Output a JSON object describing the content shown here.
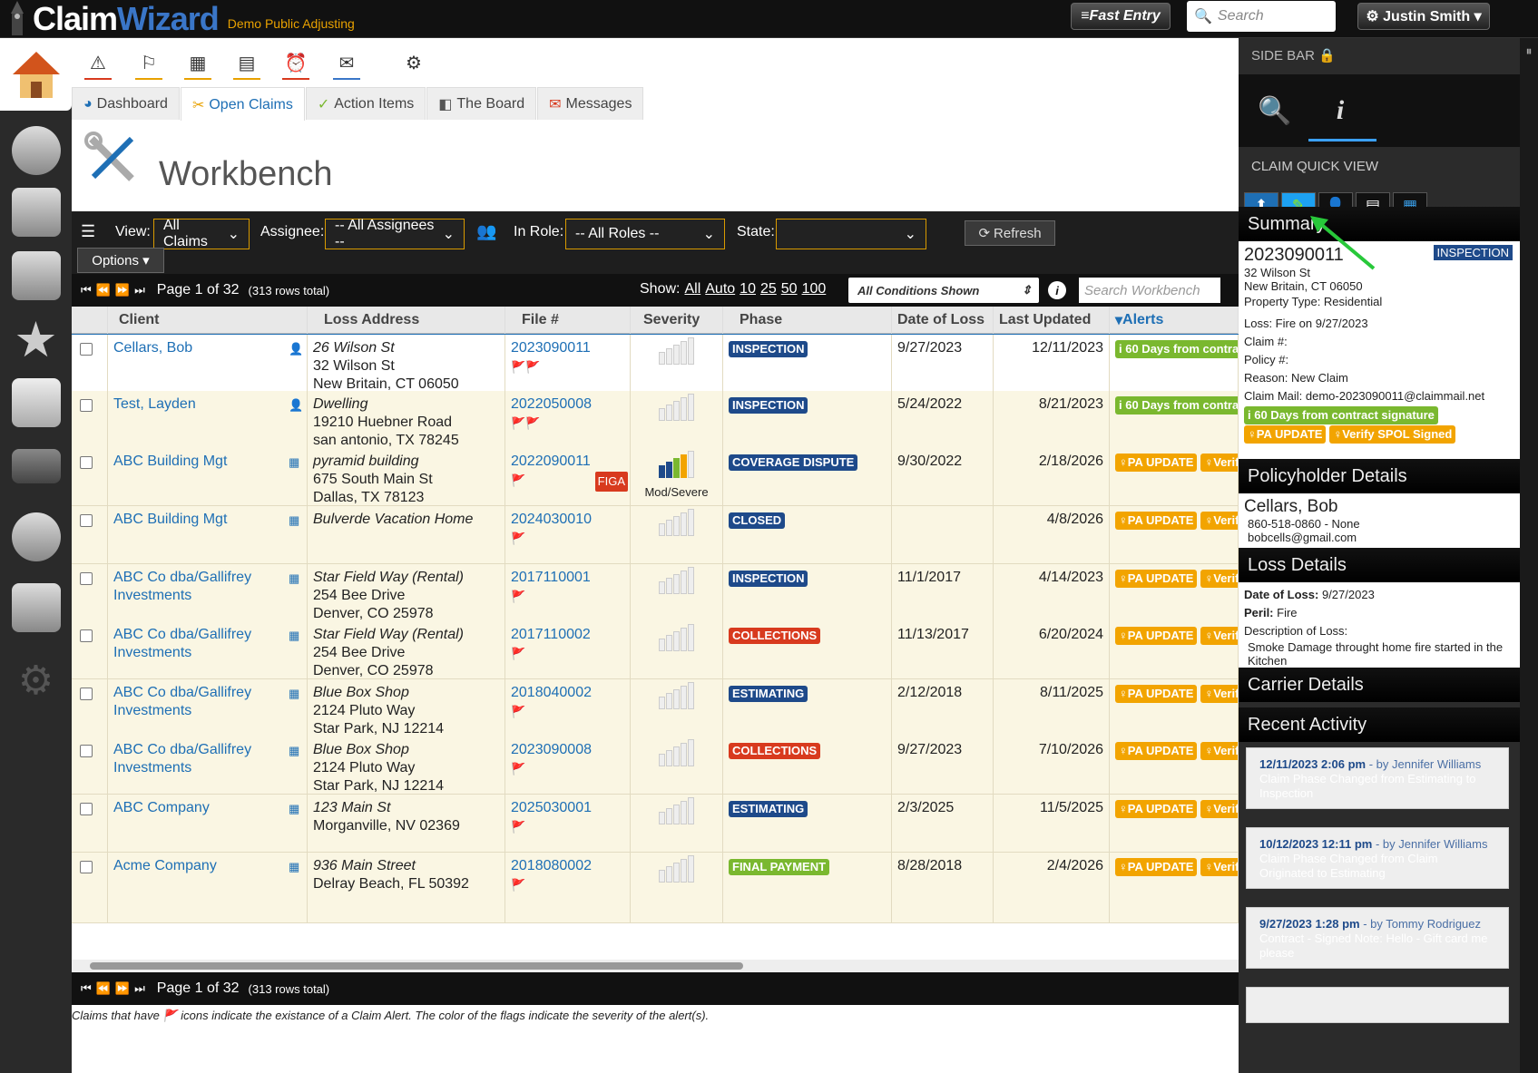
{
  "brand": {
    "name_a": "Claim",
    "name_b": "Wizard",
    "company": "Demo Public Adjusting"
  },
  "topbar": {
    "fast_entry": "≡Fast Entry",
    "search_placeholder": "Search",
    "user": "⚙ Justin Smith ▾"
  },
  "tabs": [
    {
      "icon": "pie-chart-icon",
      "label": "Dashboard"
    },
    {
      "icon": "tools-icon",
      "label": "Open Claims"
    },
    {
      "icon": "check-icon",
      "label": "Action Items"
    },
    {
      "icon": "board-icon",
      "label": "The Board"
    },
    {
      "icon": "mail-icon",
      "label": "Messages"
    }
  ],
  "page_title": "Workbench",
  "filters": {
    "view_label": "View:",
    "view_value": "All Claims",
    "assignee_label": "Assignee:",
    "assignee_value": "-- All Assignees --",
    "role_label": "In Role:",
    "role_value": "-- All Roles --",
    "state_label": "State:",
    "state_value": "",
    "refresh": "Refresh",
    "options": "Options ▾"
  },
  "pager": {
    "page_text": "Page 1 of 32",
    "rows_total": "(313 rows total)",
    "show_label": "Show:",
    "show_options": [
      "All",
      "Auto",
      "10",
      "25",
      "50",
      "100"
    ],
    "conditions": "All Conditions Shown",
    "search_placeholder": "Search Workbench"
  },
  "columns": [
    "Client",
    "Loss Address",
    "File #",
    "Severity",
    "Phase",
    "Date of Loss",
    "Last Updated",
    "Alerts"
  ],
  "rows": [
    {
      "client": "Cellars, Bob",
      "loss1": "26 Wilson St",
      "loss2": "32 Wilson St",
      "loss3": "New Britain, CT 06050",
      "file": "2023090011",
      "flags": "🚩🚩",
      "sev": 0,
      "sev_label": "",
      "figa": "",
      "phase": "INSPECTION",
      "phase_color": "#1e4a8a",
      "dol": "9/27/2023",
      "upd": "12/11/2023",
      "alert1": "60 Days from contract signature",
      "alert1_color": "green",
      "alert2": ""
    },
    {
      "client": "Test, Layden",
      "loss1": "Dwelling",
      "loss2": "19210 Huebner Road",
      "loss3": "san antonio, TX 78245",
      "file": "2022050008",
      "flags": "🚩🚩",
      "sev": 0,
      "sev_label": "",
      "figa": "",
      "phase": "INSPECTION",
      "phase_color": "#1e4a8a",
      "dol": "5/24/2022",
      "upd": "8/21/2023",
      "alert1": "60 Days from contract signature",
      "alert1_color": "green",
      "alert2": ""
    },
    {
      "client": "ABC Building Mgt",
      "loss1": "pyramid building",
      "loss2": "675 South Main St",
      "loss3": "Dallas, TX 78123",
      "file": "2022090011",
      "flags": "🚩",
      "sev": 4,
      "sev_label": "Mod/Severe",
      "figa": "FIGA",
      "phase": "COVERAGE DISPUTE",
      "phase_color": "#1e4a8a",
      "dol": "9/30/2022",
      "upd": "2/18/2026",
      "alert1": "PA UPDATE",
      "alert1_color": "orange",
      "alert2": "Verify SPOL Signed"
    },
    {
      "client": "ABC Building Mgt",
      "loss1": "Bulverde Vacation Home",
      "loss2": "",
      "loss3": "",
      "file": "2024030010",
      "flags": "🚩",
      "sev": 0,
      "sev_label": "",
      "figa": "",
      "phase": "CLOSED",
      "phase_color": "#1e4a8a",
      "dol": "",
      "upd": "4/8/2026",
      "alert1": "PA UPDATE",
      "alert1_color": "orange",
      "alert2": "Verify SPOL Signed"
    },
    {
      "client": "ABC Co dba/Gallifrey Investments",
      "loss1": "Star Field Way (Rental)",
      "loss2": "254 Bee Drive",
      "loss3": "Denver, CO 25978",
      "file": "2017110001",
      "flags": "🚩",
      "sev": 0,
      "sev_label": "",
      "figa": "",
      "phase": "INSPECTION",
      "phase_color": "#1e4a8a",
      "dol": "11/1/2017",
      "upd": "4/14/2023",
      "alert1": "PA UPDATE",
      "alert1_color": "orange",
      "alert2": "Verify SPOL Signed"
    },
    {
      "client": "ABC Co dba/Gallifrey Investments",
      "loss1": "Star Field Way (Rental)",
      "loss2": "254 Bee Drive",
      "loss3": "Denver, CO 25978",
      "file": "2017110002",
      "flags": "🚩",
      "sev": 0,
      "sev_label": "",
      "figa": "",
      "phase": "COLLECTIONS",
      "phase_color": "#d83a1e",
      "dol": "11/13/2017",
      "upd": "6/20/2024",
      "alert1": "PA UPDATE",
      "alert1_color": "orange",
      "alert2": "Verify SPOL Signed"
    },
    {
      "client": "ABC Co dba/Gallifrey Investments",
      "loss1": "Blue Box Shop",
      "loss2": "2124 Pluto Way",
      "loss3": "Star Park, NJ 12214",
      "file": "2018040002",
      "flags": "🚩",
      "sev": 0,
      "sev_label": "",
      "figa": "",
      "phase": "ESTIMATING",
      "phase_color": "#1e4a8a",
      "dol": "2/12/2018",
      "upd": "8/11/2025",
      "alert1": "PA UPDATE",
      "alert1_color": "orange",
      "alert2": "Verify SPOL Signed"
    },
    {
      "client": "ABC Co dba/Gallifrey Investments",
      "loss1": "Blue Box Shop",
      "loss2": "2124 Pluto Way",
      "loss3": "Star Park, NJ 12214",
      "file": "2023090008",
      "flags": "🚩",
      "sev": 0,
      "sev_label": "",
      "figa": "",
      "phase": "COLLECTIONS",
      "phase_color": "#d83a1e",
      "dol": "9/27/2023",
      "upd": "7/10/2026",
      "alert1": "PA UPDATE",
      "alert1_color": "orange",
      "alert2": "Verify SPOL Signed"
    },
    {
      "client": "ABC Company",
      "loss1": "123 Main St",
      "loss2": "Morganville, NV 02369",
      "loss3": "",
      "file": "2025030001",
      "flags": "🚩",
      "sev": 0,
      "sev_label": "",
      "figa": "",
      "phase": "ESTIMATING",
      "phase_color": "#1e4a8a",
      "dol": "2/3/2025",
      "upd": "11/5/2025",
      "alert1": "PA UPDATE",
      "alert1_color": "orange",
      "alert2": "Verify SPOL Signed"
    },
    {
      "client": "Acme Company",
      "loss1": "936 Main Street",
      "loss2": "Delray Beach, FL 50392",
      "loss3": "",
      "file": "2018080002",
      "flags": "🚩",
      "sev": 0,
      "sev_label": "",
      "figa": "",
      "phase": "FINAL PAYMENT",
      "phase_color": "#7ab82f",
      "dol": "8/28/2018",
      "upd": "2/4/2026",
      "alert1": "PA UPDATE",
      "alert1_color": "orange",
      "alert2": "Verify SPOL Signed"
    }
  ],
  "footnote": "Claims that have 🚩 icons indicate the existance of a Claim Alert. The color of the flags indicate the severity of the alert(s).",
  "sidebar": {
    "title": "SIDE BAR 🔒",
    "cqv": "CLAIM QUICK VIEW",
    "summary_h": "Summary",
    "claim_no": "2023090011",
    "phase": "INSPECTION",
    "addr1": "32 Wilson St",
    "addr2": "New Britain, CT 06050",
    "prop": "Property Type: Residential",
    "loss": "Loss: Fire on 9/27/2023",
    "claim": "Claim #:",
    "policy": "Policy #:",
    "reason": "Reason: New Claim",
    "mail": "Claim Mail: demo-2023090011@claimmail.net",
    "tag1": "60 Days from contract signature",
    "tag2": "PA UPDATE",
    "tag3": "Verify SPOL Signed",
    "ph_h": "Policyholder Details",
    "ph_name": "Cellars, Bob",
    "ph_phone": "860-518-0860 - None",
    "ph_email": "bobcells@gmail.com",
    "ld_h": "Loss Details",
    "dol_lbl": "Date of Loss:",
    "dol": "9/27/2023",
    "peril_lbl": "Peril:",
    "peril": "Fire",
    "desc_lbl": "Description of Loss:",
    "desc": "Smoke Damage throught home fire started in the Kitchen",
    "cd_h": "Carrier Details",
    "ra_h": "Recent Activity",
    "activity": [
      {
        "when": "12/11/2023 2:06 pm",
        "who": "- by Jennifer Williams",
        "text": "Claim Phase Changed from Estimating to Inspection"
      },
      {
        "when": "10/12/2023 12:11 pm",
        "who": "- by Jennifer Williams",
        "text": "Claim Phase Changed from Claim Originated to Estimating"
      },
      {
        "when": "9/27/2023 1:28 pm",
        "who": "- by Tommy Rodriguez",
        "text": "Contract - Signed Note: Hello - Gift card me please"
      }
    ]
  }
}
